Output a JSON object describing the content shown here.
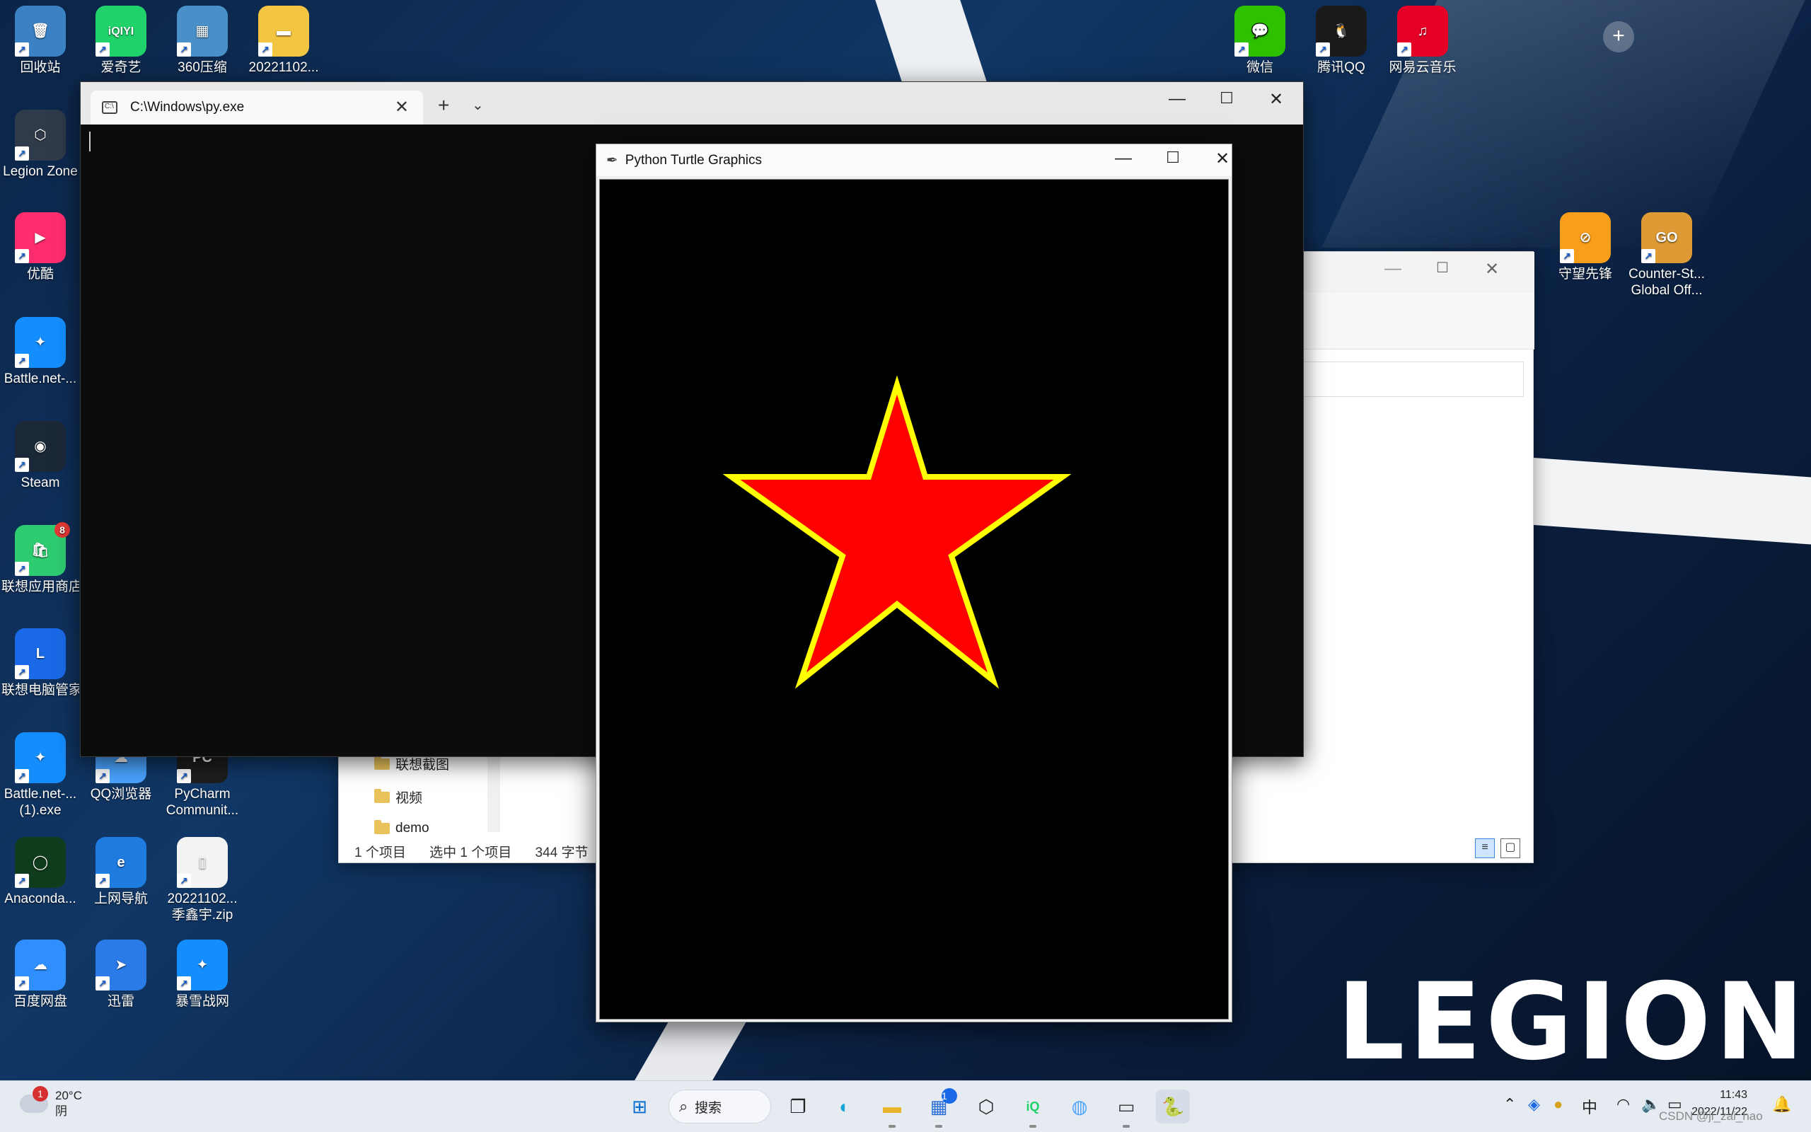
{
  "desktop": {
    "icons_left": [
      {
        "label": "回收站",
        "glyph": "🗑",
        "color": "#3b82c4"
      },
      {
        "label": "Legion Zone",
        "glyph": "⬡",
        "color": "#2f3a4a"
      },
      {
        "label": "优酷",
        "glyph": "▶",
        "color": "#ff2d6e"
      },
      {
        "label": "Battle.net-...",
        "glyph": "✦",
        "color": "#148eff"
      },
      {
        "label": "Steam",
        "glyph": "◉",
        "color": "#1b2838"
      },
      {
        "label": "联想应用商店",
        "glyph": "🛍",
        "color": "#2ecc71",
        "badge": "8"
      },
      {
        "label": "联想电脑管家",
        "glyph": "L",
        "color": "#1a6ae8"
      },
      {
        "label": "Battle.net-...\n(1).exe",
        "glyph": "✦",
        "color": "#148eff"
      },
      {
        "label": "Anaconda...",
        "glyph": "◯",
        "color": "#0f3c1c"
      },
      {
        "label": "百度网盘",
        "glyph": "☁",
        "color": "#2f8fff"
      }
    ],
    "icons_col2": [
      {
        "label": "爱奇艺",
        "glyph": "iQIYI",
        "color": "#1fd26a"
      },
      {
        "label": "QQ浏览器",
        "glyph": "☁",
        "color": "#4aa3ff"
      },
      {
        "label": "上网导航",
        "glyph": "e",
        "color": "#1e7be0"
      },
      {
        "label": "迅雷",
        "glyph": "➤",
        "color": "#2a7be8"
      }
    ],
    "icons_col3": [
      {
        "label": "360压缩",
        "glyph": "▦",
        "color": "#4a90c8"
      },
      {
        "label": "PyCharm\nCommunit...",
        "glyph": "PC",
        "color": "#1d1d1d"
      },
      {
        "label": "20221102...\n季鑫宇.zip",
        "glyph": "▯",
        "color": "#f3f3f3"
      },
      {
        "label": "暴雪战网",
        "glyph": "✦",
        "color": "#148eff"
      }
    ],
    "icons_col4": [
      {
        "label": "20221102...",
        "glyph": "▬",
        "color": "#f4c542"
      }
    ],
    "icons_top_right": [
      {
        "label": "微信",
        "glyph": "💬",
        "color": "#2dc100"
      },
      {
        "label": "腾讯QQ",
        "glyph": "🐧",
        "color": "#1a1a1a"
      },
      {
        "label": "网易云音乐",
        "glyph": "♫",
        "color": "#e60026"
      }
    ],
    "icons_right_row": [
      {
        "label": "守望先锋",
        "glyph": "⊘",
        "color": "#f99e1a"
      },
      {
        "label": "Counter-St...\nGlobal Off...",
        "glyph": "GO",
        "color": "#de9b35"
      }
    ],
    "logo": "LEGION"
  },
  "terminal": {
    "tab_title": "C:\\Windows\\py.exe",
    "close_glyph": "✕",
    "newtab_glyph": "+",
    "dropdown_glyph": "⌄",
    "minimize_glyph": "—",
    "maximize_glyph": "☐"
  },
  "explorer": {
    "nav_items": [
      "联想截图",
      "视频",
      "demo"
    ],
    "status": {
      "count": "1 个项目",
      "selected": "选中 1 个项目",
      "size": "344 字节"
    }
  },
  "turtle": {
    "title": "Python Turtle Graphics",
    "star": {
      "fill": "#ff0000",
      "stroke": "#ffff00",
      "points": 5
    }
  },
  "taskbar": {
    "weather": {
      "temp": "20°C",
      "condition": "阴",
      "badge": "1"
    },
    "search_label": "搜索",
    "store_badge": "1",
    "tray": {
      "ime": "中"
    },
    "clock": {
      "time": "11:43",
      "date": "2022/11/22"
    }
  },
  "watermark": "CSDN @ji_zai_hao"
}
